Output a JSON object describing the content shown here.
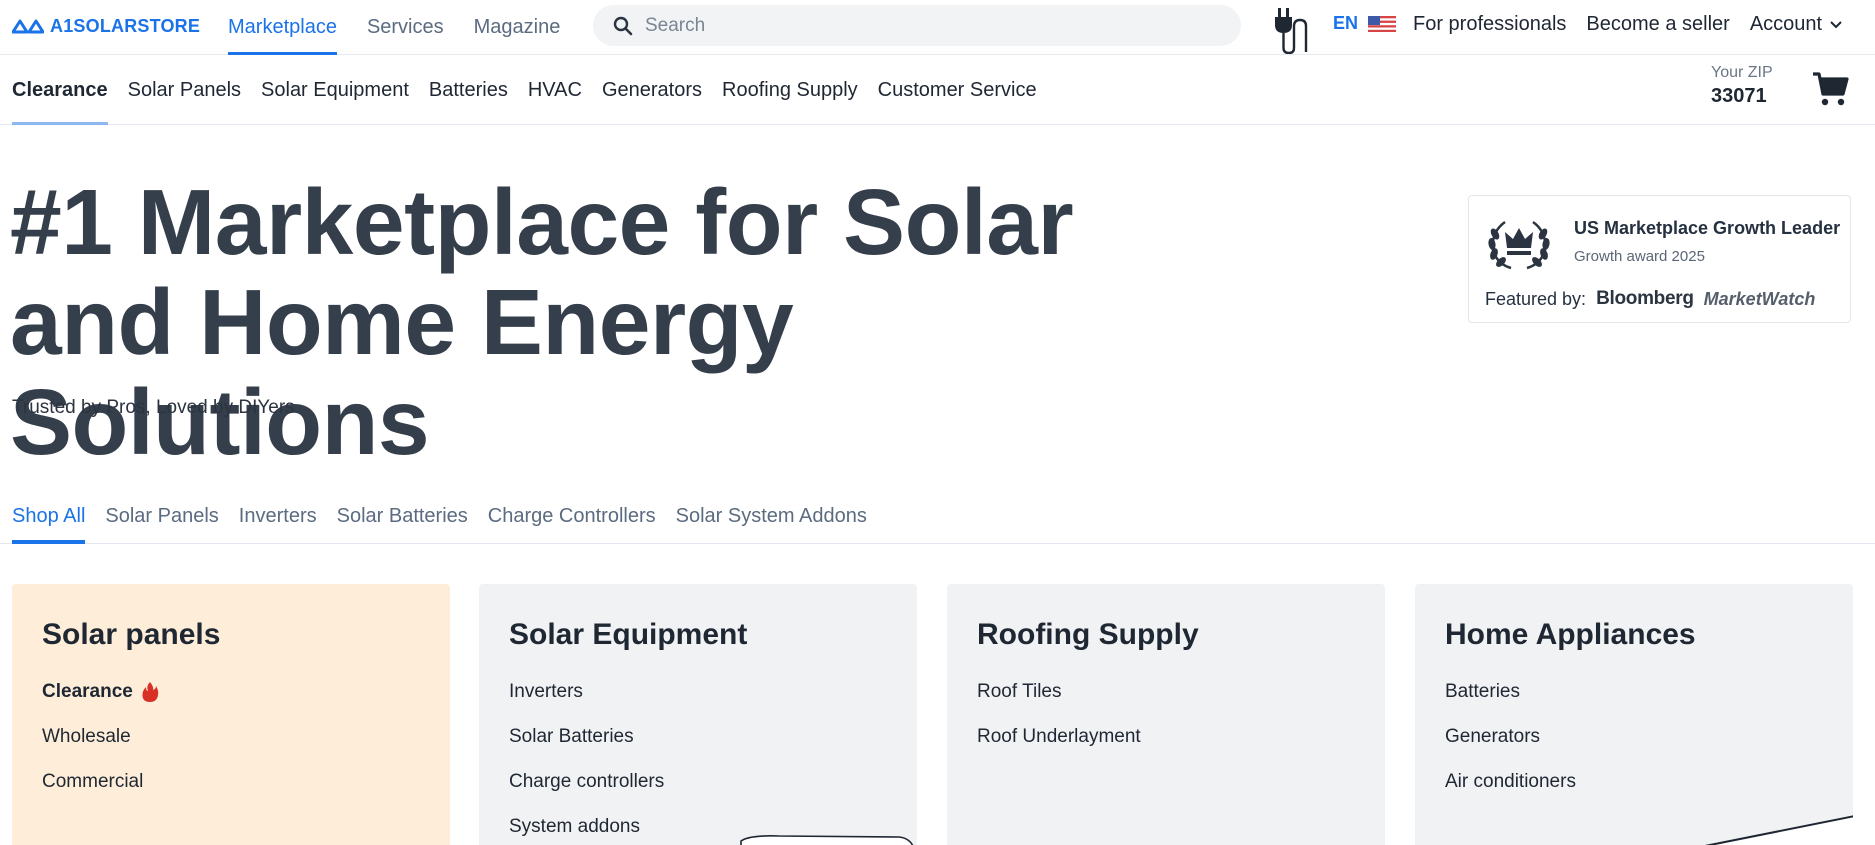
{
  "header": {
    "logo_text": "A1SOLARSTORE",
    "nav": [
      {
        "label": "Marketplace",
        "active": true
      },
      {
        "label": "Services",
        "active": false
      },
      {
        "label": "Magazine",
        "active": false
      }
    ],
    "search_placeholder": "Search",
    "language": "EN",
    "for_professionals": "For professionals",
    "become_seller": "Become a seller",
    "account": "Account"
  },
  "category_nav": {
    "items": [
      {
        "label": "Clearance",
        "active": true
      },
      {
        "label": "Solar Panels",
        "active": false
      },
      {
        "label": "Solar Equipment",
        "active": false
      },
      {
        "label": "Batteries",
        "active": false
      },
      {
        "label": "HVAC",
        "active": false
      },
      {
        "label": "Generators",
        "active": false
      },
      {
        "label": "Roofing Supply",
        "active": false
      },
      {
        "label": "Customer Service",
        "active": false
      }
    ],
    "zip_label": "Your ZIP",
    "zip_value": "33071"
  },
  "hero": {
    "title_line1": "#1 Marketplace for Solar",
    "title_line2": "and Home Energy Solutions",
    "subtitle": "Trusted by Pros, Loved by DIYers"
  },
  "award": {
    "title": "US Marketplace Growth Leader",
    "subtitle": "Growth award 2025",
    "featured_label": "Featured by:",
    "featured_1": "Bloomberg",
    "featured_2": "MarketWatch"
  },
  "shop_tabs": [
    {
      "label": "Shop All",
      "active": true
    },
    {
      "label": "Solar Panels",
      "active": false
    },
    {
      "label": "Inverters",
      "active": false
    },
    {
      "label": "Solar Batteries",
      "active": false
    },
    {
      "label": "Charge Controllers",
      "active": false
    },
    {
      "label": "Solar System Addons",
      "active": false
    }
  ],
  "cards": [
    {
      "title": "Solar panels",
      "items": [
        "Clearance",
        "Wholesale",
        "Commercial"
      ]
    },
    {
      "title": "Solar Equipment",
      "items": [
        "Inverters",
        "Solar Batteries",
        "Charge controllers",
        "System addons"
      ]
    },
    {
      "title": "Roofing Supply",
      "items": [
        "Roof Tiles",
        "Roof Underlayment"
      ]
    },
    {
      "title": "Home Appliances",
      "items": [
        "Batteries",
        "Generators",
        "Air conditioners"
      ]
    }
  ],
  "colors": {
    "accent": "#1a73e8",
    "heading": "#353f4b",
    "card_highlight": "#feeed9",
    "card_default": "#f1f2f4",
    "fire": "#d93025"
  },
  "icons": [
    "logo-icon",
    "search-icon",
    "plug-icon",
    "us-flag-icon",
    "chevron-down-icon",
    "cart-icon",
    "laurel-crown-icon",
    "fire-icon"
  ]
}
